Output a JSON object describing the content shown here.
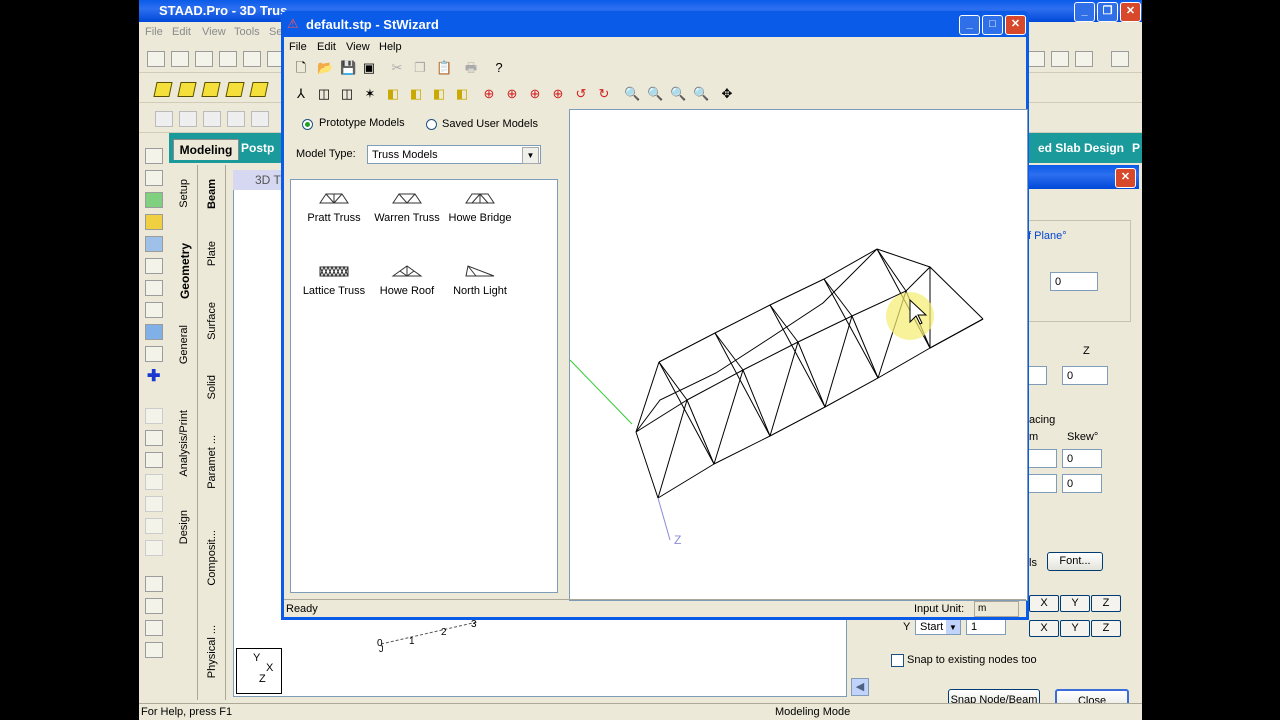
{
  "staad": {
    "title": "STAAD.Pro - 3D Trus",
    "menu": [
      "File",
      "Edit",
      "View",
      "Tools",
      "Se"
    ],
    "tabs": {
      "modeling": "Modeling",
      "post": "Postp",
      "slab": "ed Slab Design",
      "p": "P"
    },
    "vtabs_left": [
      "Setup",
      "Geometry",
      "General",
      "Analysis/Print",
      "Design"
    ],
    "vtabs_right": [
      "Beam",
      "Plate",
      "Surface",
      "Solid",
      "Paramet ...",
      "Composit...",
      "Physical ..."
    ],
    "viewport_title": "3D T",
    "axis_labels": [
      "0",
      "1",
      "2",
      "3",
      "J"
    ],
    "status_left": "For Help, press F1",
    "status_mode": "Modeling Mode"
  },
  "rdlg": {
    "plane_label": "f Plane°",
    "plane_value": "0",
    "z_label": "Z",
    "z_value": "0",
    "spacing_label": "acing",
    "m_label": "m",
    "skew_label": "Skew°",
    "skew1": "0",
    "skew2": "0",
    "ls_label": "ls",
    "font_btn": "Font...",
    "xyz": [
      "X",
      "Y",
      "Z"
    ],
    "y_label": "Y",
    "start_select": "Start",
    "count_value": "1",
    "snap_label": "Snap to existing nodes too",
    "snap_btn": "Snap Node/Beam",
    "close_btn": "Close"
  },
  "wizard": {
    "title": "default.stp - StWizard",
    "menu": [
      "File",
      "Edit",
      "View",
      "Help"
    ],
    "radio_prototype": "Prototype Models",
    "radio_saved": "Saved User Models",
    "model_type_label": "Model Type:",
    "model_type_value": "Truss Models",
    "models": [
      {
        "name": "Pratt Truss"
      },
      {
        "name": "Warren Truss"
      },
      {
        "name": "Howe Bridge"
      },
      {
        "name": "Lattice Truss"
      },
      {
        "name": "Howe Roof"
      },
      {
        "name": "North Light"
      }
    ],
    "axis_label": "Z",
    "status": "Ready",
    "input_unit_label": "Input Unit:",
    "input_unit_value": "m"
  }
}
